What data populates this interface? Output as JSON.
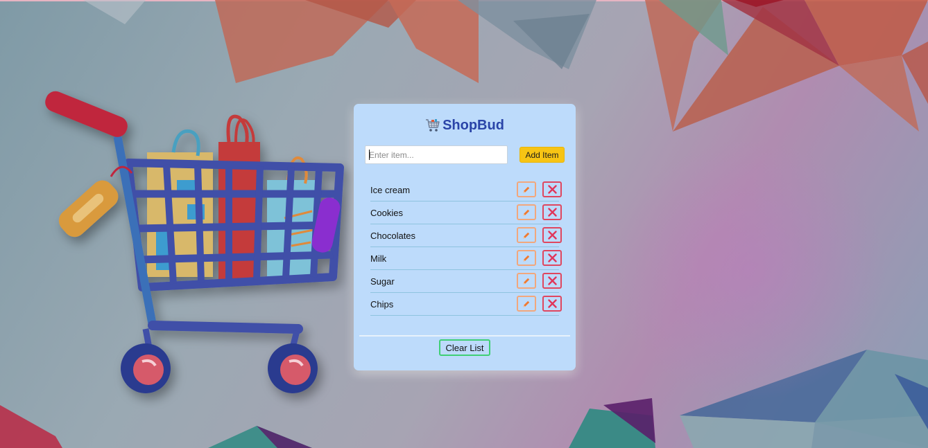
{
  "app": {
    "title": "ShopBud"
  },
  "form": {
    "input_placeholder": "Enter item...",
    "input_value": "",
    "add_label": "Add Item"
  },
  "items": [
    {
      "label": "Ice cream"
    },
    {
      "label": "Cookies"
    },
    {
      "label": "Chocolates"
    },
    {
      "label": "Milk"
    },
    {
      "label": "Sugar"
    },
    {
      "label": "Chips"
    }
  ],
  "actions": {
    "clear_label": "Clear List",
    "edit_icon": "pencil-icon",
    "delete_icon": "close-x-icon"
  },
  "colors": {
    "card_bg": "#bddbfb",
    "title": "#2a44a8",
    "add_button": "#f7c414",
    "edit_border": "#f2a77c",
    "delete_border": "#e0465e",
    "clear_border": "#3fcf75"
  }
}
